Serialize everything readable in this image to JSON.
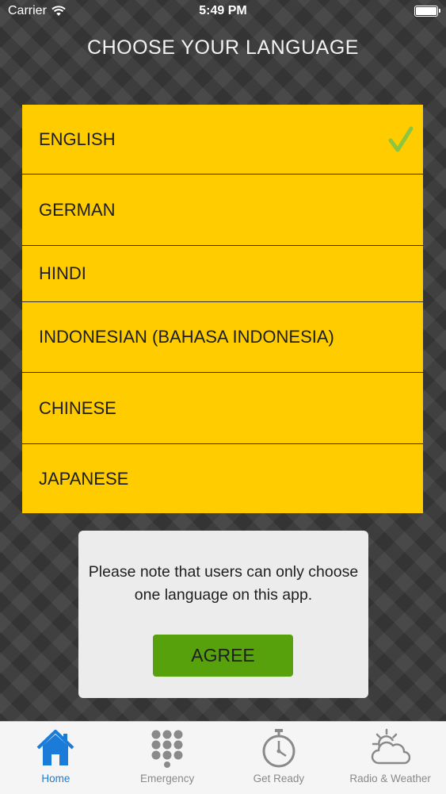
{
  "status_bar": {
    "carrier": "Carrier",
    "time": "5:49 PM"
  },
  "page": {
    "title": "CHOOSE YOUR LANGUAGE"
  },
  "languages": [
    {
      "label": "ENGLISH",
      "selected": true
    },
    {
      "label": "GERMAN",
      "selected": false
    },
    {
      "label": "HINDI",
      "selected": false
    },
    {
      "label": "INDONESIAN (BAHASA INDONESIA)",
      "selected": false
    },
    {
      "label": "CHINESE",
      "selected": false
    },
    {
      "label": "JAPANESE",
      "selected": false
    }
  ],
  "dialog": {
    "message": "Please note that users can only choose one language on this app.",
    "agree_label": "AGREE"
  },
  "tabs": [
    {
      "label": "Home",
      "icon": "home-icon",
      "active": true
    },
    {
      "label": "Emergency",
      "icon": "keypad-icon",
      "active": false
    },
    {
      "label": "Get Ready",
      "icon": "stopwatch-icon",
      "active": false
    },
    {
      "label": "Radio & Weather",
      "icon": "weather-icon",
      "active": false
    }
  ],
  "colors": {
    "accent_yellow": "#ffcc00",
    "check_green": "#8cc63f",
    "agree_green": "#57a10c",
    "tab_active": "#1a7bd8",
    "tab_inactive": "#8a8a8a"
  }
}
